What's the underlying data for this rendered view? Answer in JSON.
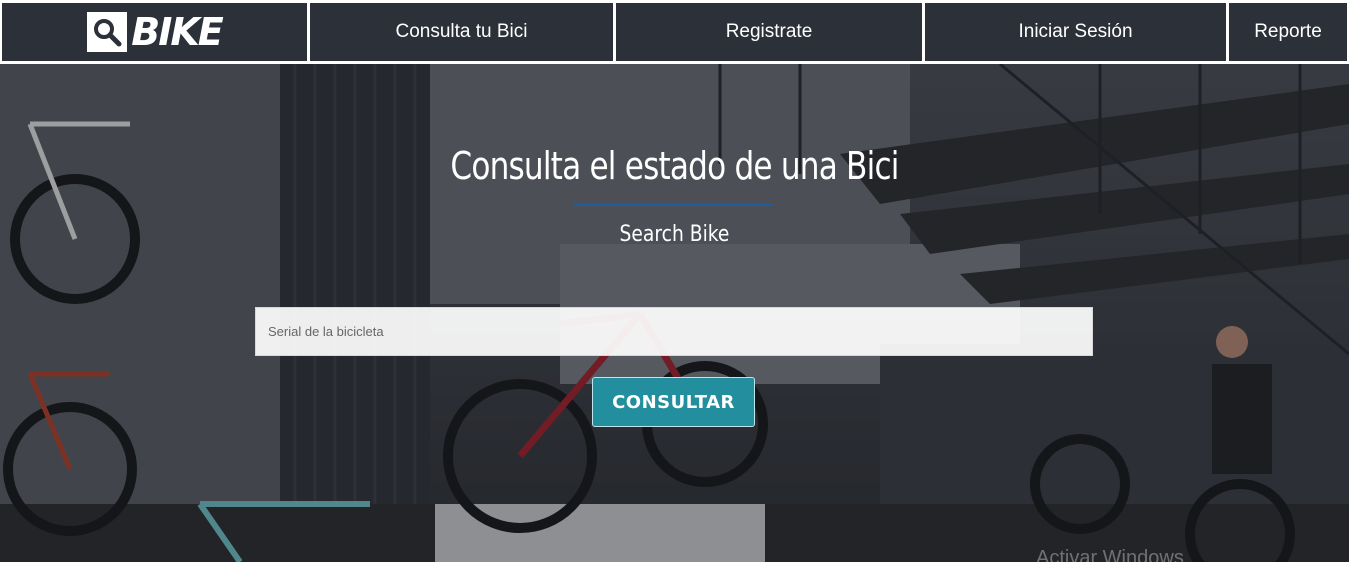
{
  "nav": {
    "logo_text": "BIKE",
    "logo_icon": "search-icon",
    "items": [
      {
        "label": "Consulta tu Bici"
      },
      {
        "label": "Registrate"
      },
      {
        "label": "Iniciar Sesión"
      },
      {
        "label": "Reporte"
      }
    ]
  },
  "hero": {
    "title": "Consulta el estado de una Bici",
    "subtitle": "Search Bike",
    "search_placeholder": "Serial de la bicicleta",
    "search_value": "",
    "button_label": "CONSULTAR",
    "watermark": "Activar Windows"
  },
  "colors": {
    "nav_bg": "#2c3039",
    "accent_rule": "#1c5e9e",
    "button_bg": "#238e9e"
  }
}
